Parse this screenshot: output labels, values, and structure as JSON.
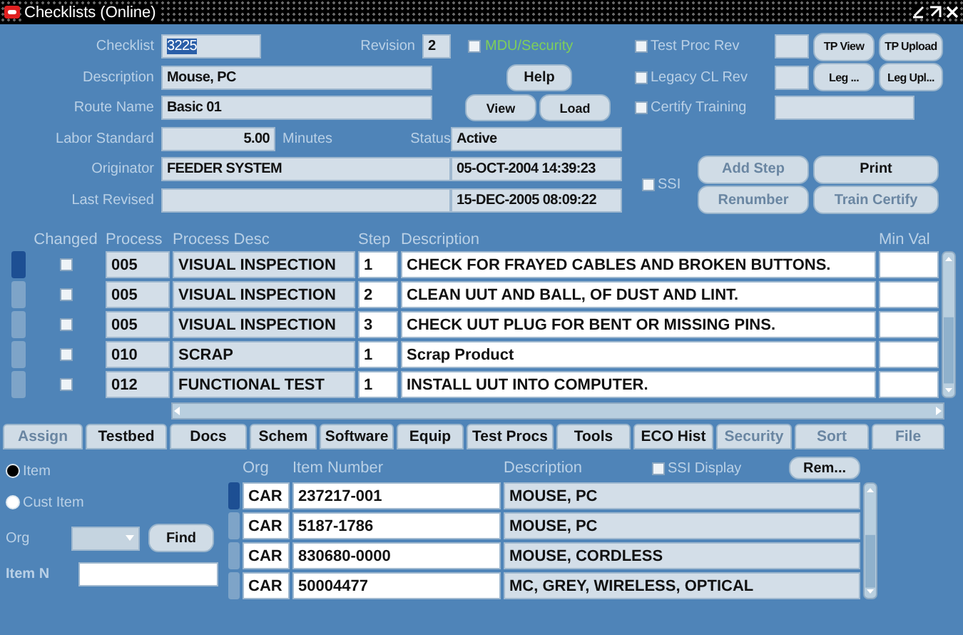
{
  "window": {
    "title": "Checklists (Online)"
  },
  "header": {
    "checklist": {
      "label": "Checklist",
      "value": "3225",
      "text_selected": true
    },
    "revision": {
      "label": "Revision",
      "value": "2"
    },
    "description": {
      "label": "Description",
      "value": "Mouse, PC"
    },
    "route_name": {
      "label": "Route Name",
      "value": "Basic 01"
    },
    "labor_standard": {
      "label": "Labor Standard",
      "value": "5.00",
      "unit": "Minutes"
    },
    "status": {
      "label": "Status",
      "value": "Active"
    },
    "originator": {
      "label": "Originator",
      "value": "FEEDER SYSTEM",
      "date": "05-OCT-2004 14:39:23"
    },
    "last_revised": {
      "label": "Last Revised",
      "date": "15-DEC-2005 08:09:22"
    }
  },
  "mdu_security": {
    "label": "MDU/Security",
    "checked": false
  },
  "help_button": {
    "label": "Help",
    "disabled": false
  },
  "view_load_buttons": [
    {
      "label": "View",
      "disabled": false
    },
    {
      "label": "Load",
      "disabled": false
    }
  ],
  "review_options": [
    {
      "label": "Test Proc Rev",
      "checked": false,
      "kind": "small"
    },
    {
      "label": "Legacy CL Rev",
      "checked": false,
      "kind": "small"
    },
    {
      "label": "Certify Training",
      "checked": false,
      "kind": "wide"
    }
  ],
  "tp_buttons": [
    {
      "label": "TP View",
      "disabled": false
    },
    {
      "label": "TP Upload",
      "disabled": false
    },
    {
      "label": "Leg ...",
      "disabled": false
    },
    {
      "label": "Leg Upl...",
      "disabled": false
    }
  ],
  "ssi": {
    "label": "SSI",
    "checked": false
  },
  "action_buttons": [
    {
      "label": "Add Step",
      "disabled": true
    },
    {
      "label": "Print",
      "disabled": false
    },
    {
      "label": "Renumber",
      "disabled": true
    },
    {
      "label": "Train Certify",
      "disabled": true
    }
  ],
  "steps_table": {
    "columns": [
      "Changed",
      "Process",
      "Process Desc",
      "Step",
      "Description",
      "Min Val"
    ],
    "rows": [
      {
        "selected": true,
        "changed": false,
        "process": "005",
        "process_desc": "VISUAL INSPECTION",
        "step": "1",
        "description": "CHECK FOR FRAYED CABLES AND BROKEN BUTTONS."
      },
      {
        "selected": false,
        "changed": false,
        "process": "005",
        "process_desc": "VISUAL INSPECTION",
        "step": "2",
        "description": "CLEAN UUT AND BALL, OF DUST AND LINT."
      },
      {
        "selected": false,
        "changed": false,
        "process": "005",
        "process_desc": "VISUAL INSPECTION",
        "step": "3",
        "description": "CHECK UUT PLUG FOR BENT OR MISSING PINS."
      },
      {
        "selected": false,
        "changed": false,
        "process": "010",
        "process_desc": "SCRAP",
        "step": "1",
        "description": "Scrap Product"
      },
      {
        "selected": false,
        "changed": false,
        "process": "012",
        "process_desc": "FUNCTIONAL TEST",
        "step": "1",
        "description": "INSTALL UUT INTO COMPUTER."
      }
    ]
  },
  "tabs": [
    {
      "label": "Assign",
      "disabled": true
    },
    {
      "label": "Testbed",
      "disabled": false
    },
    {
      "label": "Docs",
      "disabled": false
    },
    {
      "label": "Schem",
      "disabled": false
    },
    {
      "label": "Software",
      "disabled": false
    },
    {
      "label": "Equip",
      "disabled": false
    },
    {
      "label": "Test Procs",
      "disabled": false
    },
    {
      "label": "Tools",
      "disabled": false
    },
    {
      "label": "ECO Hist",
      "disabled": false
    },
    {
      "label": "Security",
      "disabled": true
    },
    {
      "label": "Sort",
      "disabled": true
    },
    {
      "label": "File",
      "disabled": true
    }
  ],
  "item_search": {
    "radios": [
      {
        "label": "Item",
        "selected": true
      },
      {
        "label": "Cust Item",
        "selected": false
      }
    ],
    "org_label": "Org",
    "find_button": "Find",
    "item_label": "Item N"
  },
  "items_table": {
    "columns": [
      "Org",
      "Item Number",
      "Description"
    ],
    "ssi_display": {
      "label": "SSI Display",
      "checked": false
    },
    "rem_button": "Rem...",
    "rows": [
      {
        "selected": true,
        "org": "CAR",
        "item_number": "237217-001",
        "description": "MOUSE, PC"
      },
      {
        "selected": false,
        "org": "CAR",
        "item_number": "5187-1786",
        "description": "MOUSE, PC"
      },
      {
        "selected": false,
        "org": "CAR",
        "item_number": "830680-0000",
        "description": "MOUSE, CORDLESS"
      },
      {
        "selected": false,
        "org": "CAR",
        "item_number": "50004477",
        "description": "MC, GREY, WIRELESS, OPTICAL"
      }
    ]
  }
}
